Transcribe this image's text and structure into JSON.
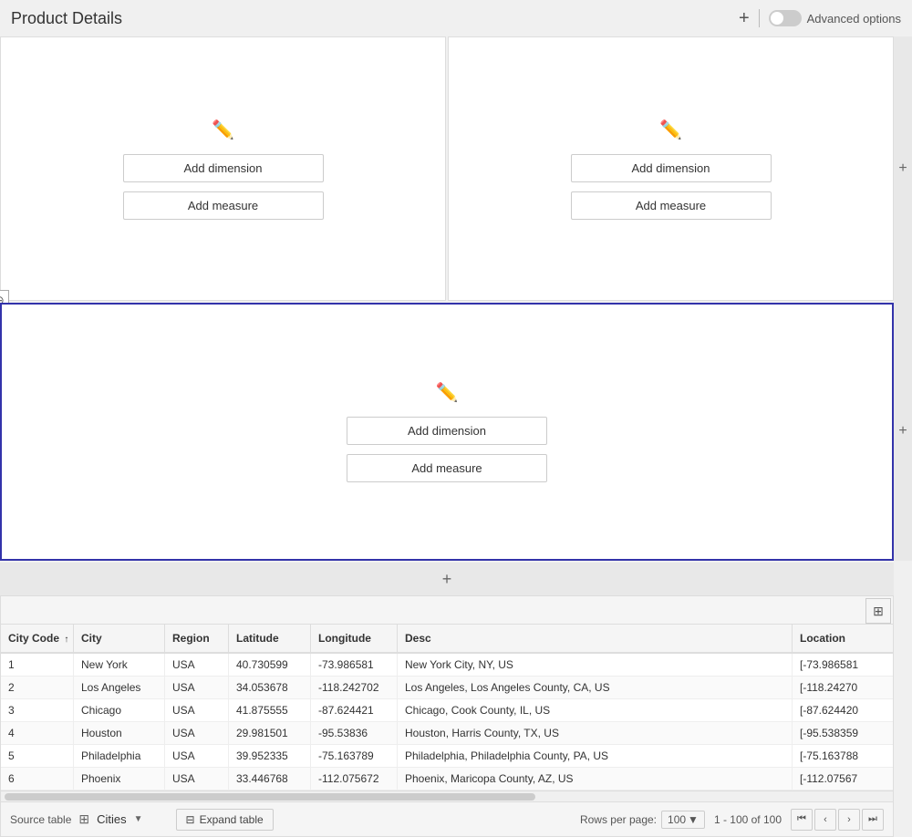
{
  "header": {
    "title": "Product Details",
    "add_button_label": "+",
    "advanced_options_label": "Advanced options"
  },
  "panels": {
    "top_left": {
      "add_dimension_label": "Add dimension",
      "add_measure_label": "Add measure"
    },
    "top_right": {
      "add_dimension_label": "Add dimension",
      "add_measure_label": "Add measure"
    },
    "bottom": {
      "add_dimension_label": "Add dimension",
      "add_measure_label": "Add measure"
    }
  },
  "table": {
    "columns": [
      {
        "key": "citycode",
        "label": "City Code",
        "sortable": true
      },
      {
        "key": "city",
        "label": "City"
      },
      {
        "key": "region",
        "label": "Region"
      },
      {
        "key": "latitude",
        "label": "Latitude"
      },
      {
        "key": "longitude",
        "label": "Longitude"
      },
      {
        "key": "desc",
        "label": "Desc"
      },
      {
        "key": "location",
        "label": "Location"
      }
    ],
    "rows": [
      {
        "citycode": "1",
        "city": "New York",
        "region": "USA",
        "latitude": "40.730599",
        "longitude": "-73.986581",
        "desc": "New York City, NY, US",
        "location": "[-73.986581"
      },
      {
        "citycode": "2",
        "city": "Los Angeles",
        "region": "USA",
        "latitude": "34.053678",
        "longitude": "-118.242702",
        "desc": "Los Angeles, Los Angeles County, CA, US",
        "location": "[-118.24270"
      },
      {
        "citycode": "3",
        "city": "Chicago",
        "region": "USA",
        "latitude": "41.875555",
        "longitude": "-87.624421",
        "desc": "Chicago, Cook County, IL, US",
        "location": "[-87.624420"
      },
      {
        "citycode": "4",
        "city": "Houston",
        "region": "USA",
        "latitude": "29.981501",
        "longitude": "-95.53836",
        "desc": "Houston, Harris County, TX, US",
        "location": "[-95.538359"
      },
      {
        "citycode": "5",
        "city": "Philadelphia",
        "region": "USA",
        "latitude": "39.952335",
        "longitude": "-75.163789",
        "desc": "Philadelphia, Philadelphia County, PA, US",
        "location": "[-75.163788"
      },
      {
        "citycode": "6",
        "city": "Phoenix",
        "region": "USA",
        "latitude": "33.446768",
        "longitude": "-112.075672",
        "desc": "Phoenix, Maricopa County, AZ, US",
        "location": "[-112.07567"
      }
    ]
  },
  "footer": {
    "source_label": "Source table",
    "table_name": "Cities",
    "expand_table_label": "Expand table",
    "rows_per_page_label": "Rows per page:",
    "rows_per_page_value": "100",
    "page_info": "1 - 100 of 100"
  }
}
